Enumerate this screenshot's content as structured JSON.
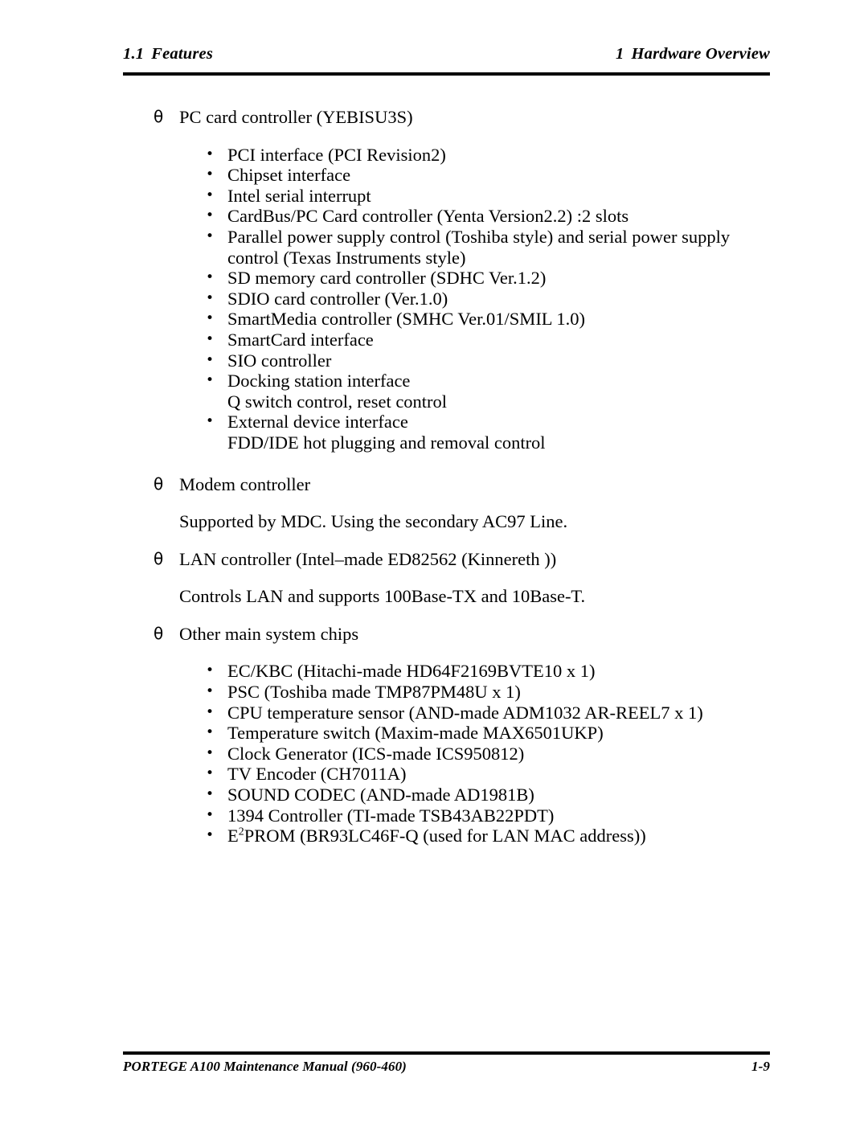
{
  "header": {
    "section_number": "1.1",
    "section_title": "Features",
    "chapter_number": "1",
    "chapter_title": "Hardware Overview"
  },
  "footer": {
    "manual_title": "PORTEGE A100 Maintenance Manual (960-460)",
    "page_number": "1-9"
  },
  "markers": {
    "level1": "θ",
    "level2": "•"
  },
  "sections": [
    {
      "heading": "PC card controller (YEBISU3S)",
      "items": [
        {
          "text": "PCI interface (PCI Revision2)"
        },
        {
          "text": "Chipset interface"
        },
        {
          "text": "Intel serial interrupt"
        },
        {
          "text": "CardBus/PC Card controller (Yenta Version2.2) :2 slots"
        },
        {
          "text": "Parallel power supply control (Toshiba style) and serial power supply control (Texas Instruments style)"
        },
        {
          "text": "SD memory card controller (SDHC Ver.1.2)"
        },
        {
          "text": "SDIO card controller (Ver.1.0)"
        },
        {
          "text": "SmartMedia controller (SMHC Ver.01/SMIL 1.0)"
        },
        {
          "text": "SmartCard interface"
        },
        {
          "text": "SIO controller"
        },
        {
          "text": "Docking station interface",
          "continuation": "Q switch control, reset control"
        },
        {
          "text": "External device interface",
          "continuation": "FDD/IDE hot plugging and removal control"
        }
      ]
    },
    {
      "heading": "Modem controller",
      "paragraph": "Supported by MDC. Using the secondary AC97 Line."
    },
    {
      "heading": "LAN controller (Intel–made ED82562 (Kinnereth ))",
      "paragraph": "Controls LAN and supports 100Base-TX and 10Base‑T."
    },
    {
      "heading": "Other main system chips",
      "items": [
        {
          "text": "EC/KBC (Hitachi‑made HD64F2169BVTE10 x 1)"
        },
        {
          "text": "PSC (Toshiba made TMP87PM48U x 1)"
        },
        {
          "text": "CPU temperature sensor (AND‑made ADM1032 AR-REEL7 x 1)"
        },
        {
          "text": "Temperature switch (Maxim‑made MAX6501UKP)"
        },
        {
          "text": "Clock Generator (ICS-made ICS950812)"
        },
        {
          "text": "TV Encoder (CH7011A)"
        },
        {
          "text": "SOUND CODEC (AND‑made AD1981B)"
        },
        {
          "text": "1394 Controller (TI‑made TSB43AB22PDT)"
        },
        {
          "text": "E2PROM (BR93LC46F-Q (used for LAN MAC address))",
          "superscript": {
            "base": "E",
            "sup": "2",
            "rest": "PROM (BR93LC46F-Q (used for LAN MAC address))"
          }
        }
      ]
    }
  ]
}
